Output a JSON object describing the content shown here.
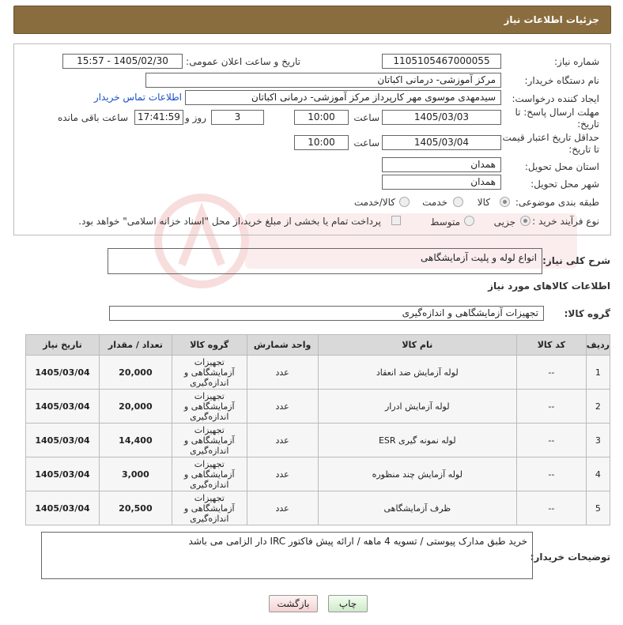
{
  "header": {
    "title": "جزئیات اطلاعات نیاز"
  },
  "form": {
    "need_number_label": "شماره نیاز:",
    "need_number": "1105105467000055",
    "announce_label": "تاریخ و ساعت اعلان عمومی:",
    "announce_value": "1405/02/30 - 15:57",
    "buyer_org_label": "نام دستگاه خریدار:",
    "buyer_org": "مرکز آموزشی- درمانی اکباتان",
    "requester_label": "ایجاد کننده درخواست:",
    "requester": "سیدمهدی موسوی مهر کارپرداز مرکز آموزشی- درمانی اکباتان",
    "contact_link": "اطلاعات تماس خریدار",
    "deadline_label_1": "مهلت ارسال پاسخ: تا",
    "deadline_label_2": "تاریخ:",
    "deadline_date": "1405/03/03",
    "time_label": "ساعت",
    "deadline_time": "10:00",
    "days_value": "3",
    "days_label": "روز و",
    "remaining_time": "17:41:59",
    "remaining_label": "ساعت باقی مانده",
    "price_validity_label_1": "حداقل تاریخ اعتبار قیمت:",
    "price_validity_label_2": "تا تاریخ:",
    "price_validity_date": "1405/03/04",
    "price_validity_time": "10:00",
    "province_label": "استان محل تحویل:",
    "province": "همدان",
    "city_label": "شهر محل تحویل:",
    "city": "همدان",
    "category_label": "طبقه بندی موضوعی:",
    "category_options": [
      "کالا",
      "خدمت",
      "کالا/خدمت"
    ],
    "category_selected": "کالا",
    "process_label": "نوع فرآیند خرید :",
    "process_options": [
      "جزیی",
      "متوسط"
    ],
    "process_selected": "جزیی",
    "payment_note": "پرداخت تمام یا بخشی از مبلغ خرید،از محل \"اسناد خزانه اسلامی\" خواهد بود."
  },
  "description": {
    "label": "شرح کلی نیاز:",
    "value": "انواع لوله و پلیت آزمایشگاهی"
  },
  "goods_info_title": "اطلاعات کالاهای مورد نیاز",
  "goods_group": {
    "label": "گروه کالا:",
    "value": "تجهیزات آزمایشگاهی و اندازه‌گیری"
  },
  "table": {
    "headers": [
      "ردیف",
      "کد کالا",
      "نام کالا",
      "واحد شمارش",
      "گروه کالا",
      "تعداد / مقدار",
      "تاریخ نیاز"
    ],
    "rows": [
      [
        "1",
        "--",
        "لوله آزمایش ضد انعقاد",
        "عدد",
        "تجهیزات آزمایشگاهی و اندازه‌گیری",
        "20,000",
        "1405/03/04"
      ],
      [
        "2",
        "--",
        "لوله آزمایش ادرار",
        "عدد",
        "تجهیزات آزمایشگاهی و اندازه‌گیری",
        "20,000",
        "1405/03/04"
      ],
      [
        "3",
        "--",
        "لوله نمونه گیری ESR",
        "عدد",
        "تجهیزات آزمایشگاهی و اندازه‌گیری",
        "14,400",
        "1405/03/04"
      ],
      [
        "4",
        "--",
        "لوله آزمایش چند منظوره",
        "عدد",
        "تجهیزات آزمایشگاهی و اندازه‌گیری",
        "3,000",
        "1405/03/04"
      ],
      [
        "5",
        "--",
        "ظرف آزمایشگاهی",
        "عدد",
        "تجهیزات آزمایشگاهی و اندازه‌گیری",
        "20,500",
        "1405/03/04"
      ]
    ]
  },
  "buyer_notes": {
    "label": "توضیحات خریدار:",
    "value": "خرید طبق مدارک پیوستی / تسویه 4 ماهه / ارائه پیش فاکتور IRC دار الزامی می باشد"
  },
  "buttons": {
    "print": "چاپ",
    "back": "بازگشت"
  }
}
